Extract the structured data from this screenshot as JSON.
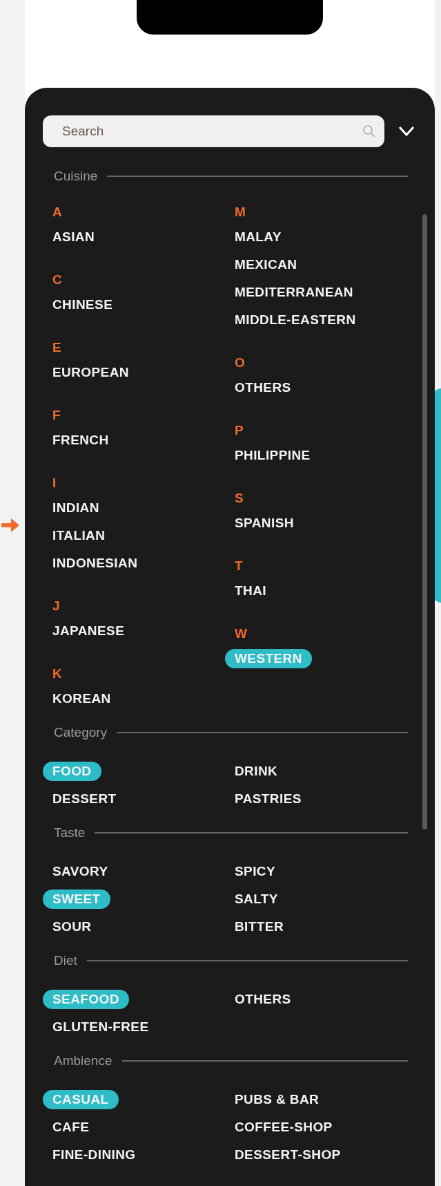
{
  "filter_panel": {
    "search_placeholder": "Search",
    "sections": [
      {
        "title": "Cuisine",
        "kind": "alphabetical",
        "columns": [
          [
            {
              "letter": "A",
              "items": [
                {
                  "label": "ASIAN",
                  "selected": false
                }
              ]
            },
            {
              "letter": "C",
              "items": [
                {
                  "label": "CHINESE",
                  "selected": false
                }
              ]
            },
            {
              "letter": "E",
              "items": [
                {
                  "label": "EUROPEAN",
                  "selected": false
                }
              ]
            },
            {
              "letter": "F",
              "items": [
                {
                  "label": "FRENCH",
                  "selected": false
                }
              ]
            },
            {
              "letter": "I",
              "items": [
                {
                  "label": "INDIAN",
                  "selected": false
                },
                {
                  "label": "ITALIAN",
                  "selected": false
                },
                {
                  "label": "INDONESIAN",
                  "selected": false
                }
              ]
            },
            {
              "letter": "J",
              "items": [
                {
                  "label": "JAPANESE",
                  "selected": false
                }
              ]
            },
            {
              "letter": "K",
              "items": [
                {
                  "label": "KOREAN",
                  "selected": false
                }
              ]
            }
          ],
          [
            {
              "letter": "M",
              "items": [
                {
                  "label": "MALAY",
                  "selected": false
                },
                {
                  "label": "MEXICAN",
                  "selected": false
                },
                {
                  "label": "MEDITERRANEAN",
                  "selected": false
                },
                {
                  "label": "MIDDLE-EASTERN",
                  "selected": false
                }
              ]
            },
            {
              "letter": "O",
              "items": [
                {
                  "label": "OTHERS",
                  "selected": false
                }
              ]
            },
            {
              "letter": "P",
              "items": [
                {
                  "label": "PHILIPPINE",
                  "selected": false
                }
              ]
            },
            {
              "letter": "S",
              "items": [
                {
                  "label": "SPANISH",
                  "selected": false
                }
              ]
            },
            {
              "letter": "T",
              "items": [
                {
                  "label": "THAI",
                  "selected": false
                }
              ]
            },
            {
              "letter": "W",
              "items": [
                {
                  "label": "WESTERN",
                  "selected": true
                }
              ]
            }
          ]
        ]
      },
      {
        "title": "Category",
        "kind": "grid",
        "items": [
          {
            "label": "FOOD",
            "selected": true
          },
          {
            "label": "DRINK",
            "selected": false
          },
          {
            "label": "DESSERT",
            "selected": false
          },
          {
            "label": "PASTRIES",
            "selected": false
          }
        ]
      },
      {
        "title": "Taste",
        "kind": "grid",
        "items": [
          {
            "label": "SAVORY",
            "selected": false
          },
          {
            "label": "SPICY",
            "selected": false
          },
          {
            "label": "SWEET",
            "selected": true
          },
          {
            "label": "SALTY",
            "selected": false
          },
          {
            "label": "SOUR",
            "selected": false
          },
          {
            "label": "BITTER",
            "selected": false
          }
        ]
      },
      {
        "title": "Diet",
        "kind": "grid",
        "items": [
          {
            "label": "SEAFOOD",
            "selected": true
          },
          {
            "label": "OTHERS",
            "selected": false
          },
          {
            "label": "GLUTEN-FREE",
            "selected": false
          }
        ]
      },
      {
        "title": "Ambience",
        "kind": "grid",
        "items": [
          {
            "label": "CASUAL",
            "selected": true
          },
          {
            "label": "PUBS & BAR",
            "selected": false
          },
          {
            "label": "CAFE",
            "selected": false
          },
          {
            "label": "COFFEE-SHOP",
            "selected": false
          },
          {
            "label": "FINE-DINING",
            "selected": false
          },
          {
            "label": "DESSERT-SHOP",
            "selected": false
          }
        ]
      }
    ]
  }
}
